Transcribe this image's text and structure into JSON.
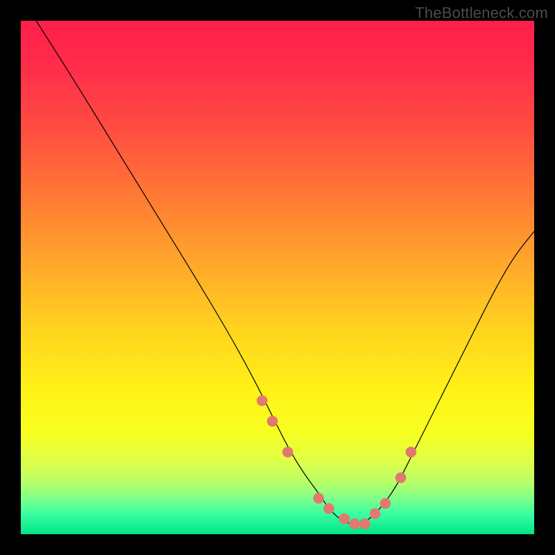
{
  "watermark": "TheBottleneck.com",
  "colors": {
    "dot": "#e2786f",
    "curve": "#000000",
    "gradient_stops": [
      {
        "offset": 0.0,
        "color": "#ff1e4b"
      },
      {
        "offset": 0.1,
        "color": "#ff2f4a"
      },
      {
        "offset": 0.22,
        "color": "#ff5040"
      },
      {
        "offset": 0.35,
        "color": "#ff7c33"
      },
      {
        "offset": 0.48,
        "color": "#ffaa2a"
      },
      {
        "offset": 0.6,
        "color": "#ffd31f"
      },
      {
        "offset": 0.72,
        "color": "#fff217"
      },
      {
        "offset": 0.8,
        "color": "#f8ff1f"
      },
      {
        "offset": 0.86,
        "color": "#ddff4a"
      },
      {
        "offset": 0.9,
        "color": "#b6ff6a"
      },
      {
        "offset": 0.93,
        "color": "#7fff88"
      },
      {
        "offset": 0.96,
        "color": "#3bffa2"
      },
      {
        "offset": 1.0,
        "color": "#00e488"
      }
    ]
  },
  "chart_data": {
    "type": "line",
    "title": "",
    "xlabel": "",
    "ylabel": "",
    "xlim": [
      0,
      100
    ],
    "ylim": [
      0,
      100
    ],
    "grid": false,
    "legend": false,
    "series": [
      {
        "name": "curve",
        "x": [
          3,
          10,
          18,
          26,
          34,
          40,
          45,
          49,
          52,
          55,
          58,
          60,
          62,
          64,
          66,
          68,
          70,
          73,
          76,
          80,
          84,
          88,
          92,
          96,
          100
        ],
        "y": [
          100,
          89,
          76,
          63,
          50,
          40,
          31,
          23,
          17,
          12,
          8,
          5,
          3,
          2,
          2,
          3,
          5,
          9,
          15,
          23,
          31,
          39,
          47,
          54,
          59
        ]
      }
    ],
    "points": {
      "name": "markers",
      "x": [
        47,
        49,
        52,
        58,
        60,
        63,
        65,
        67,
        69,
        71,
        74,
        76
      ],
      "y": [
        26,
        22,
        16,
        7,
        5,
        3,
        2,
        2,
        4,
        6,
        11,
        16
      ]
    }
  }
}
